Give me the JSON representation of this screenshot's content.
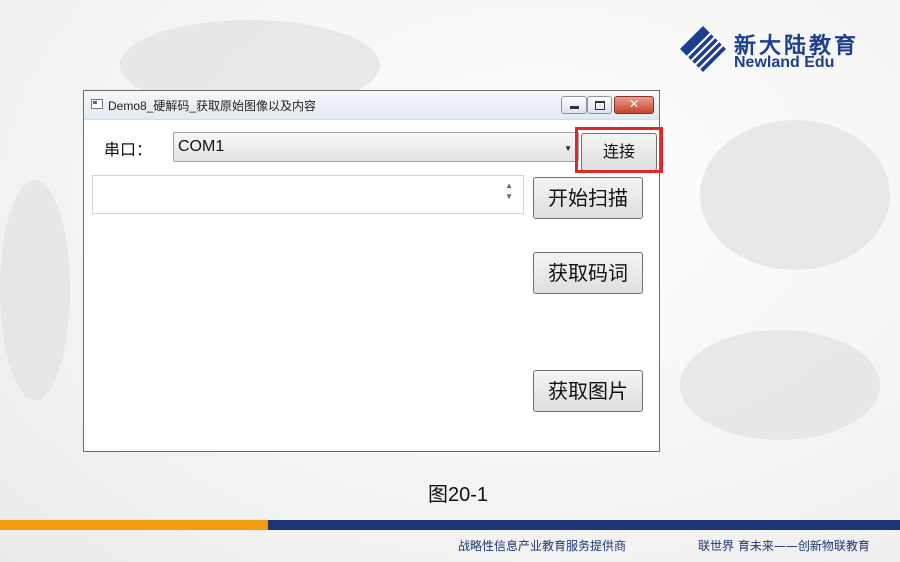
{
  "logo": {
    "cn": "新大陆教育",
    "en": "Newland Edu",
    "color": "#1d3f8f"
  },
  "window": {
    "title": "Demo8_硬解码_获取原始图像以及内容",
    "icon": "app-window-icon",
    "controls": [
      "minimize-icon",
      "maximize-icon",
      "close-icon"
    ]
  },
  "form": {
    "port_label": "串口：",
    "port_value": "COM1",
    "connect_label": "连接",
    "scan_label": "开始扫描",
    "get_code_label": "获取码词",
    "get_image_label": "获取图片",
    "highlight_color": "#e02828"
  },
  "caption": "图20-1",
  "footer": {
    "left": "战略性信息产业教育服务提供商",
    "right": "联世界 育未来——创新物联教育",
    "accent_orange": "#f39c11",
    "accent_navy": "#1d3575"
  }
}
